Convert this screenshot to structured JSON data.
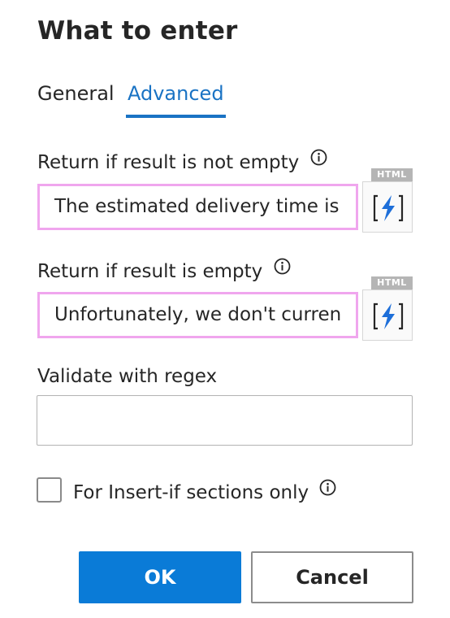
{
  "dialog": {
    "title": "What to enter"
  },
  "tabs": [
    {
      "label": "General",
      "active": false
    },
    {
      "label": "Advanced",
      "active": true
    }
  ],
  "fields": {
    "not_empty": {
      "label": "Return if result is not empty",
      "badge": "HTML",
      "value": "The estimated delivery time is"
    },
    "empty": {
      "label": "Return if result is empty",
      "badge": "HTML",
      "value": "Unfortunately, we don't curren"
    },
    "regex": {
      "label": "Validate with regex",
      "value": ""
    }
  },
  "checkbox": {
    "label": "For Insert-if sections only",
    "checked": false
  },
  "buttons": {
    "ok": "OK",
    "cancel": "Cancel"
  },
  "icons": {
    "info": "info-icon",
    "insert_variable": "bracket-lightning-icon"
  },
  "colors": {
    "accent": "#1a73c4",
    "primary_button": "#0a7bd7",
    "field_highlight": "#f0a6ee",
    "lightning": "#1e6fd9",
    "badge": "#b5b5b5"
  }
}
